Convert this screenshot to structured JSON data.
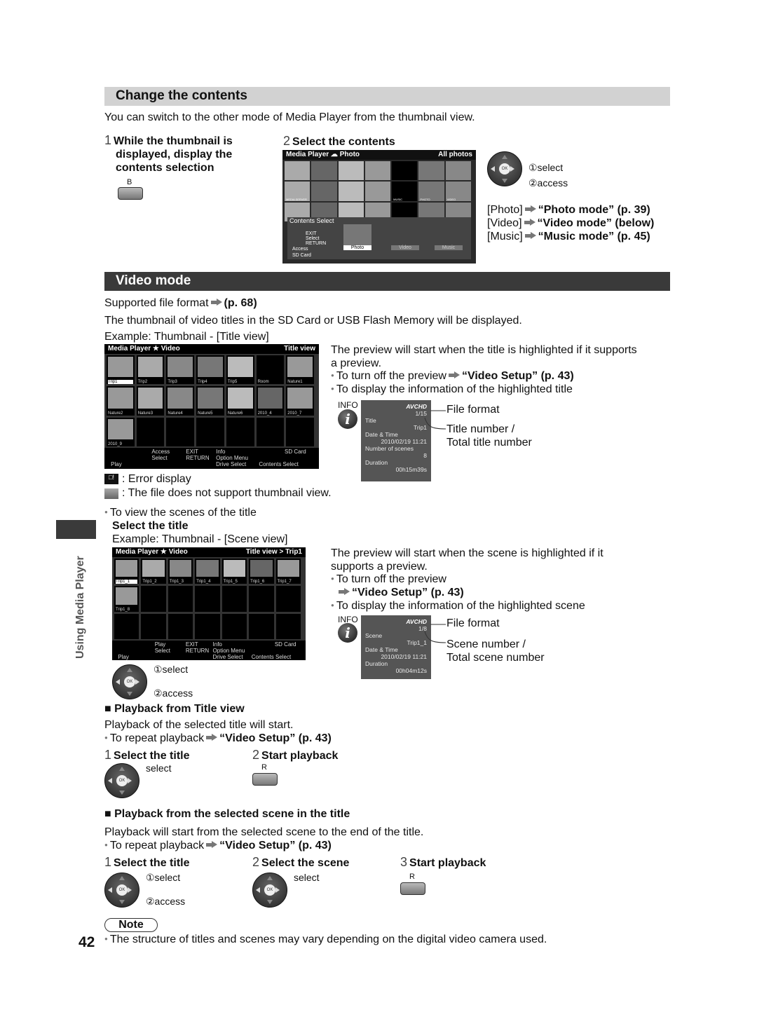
{
  "change": {
    "title": "Change the contents",
    "intro": "You can switch to the other mode of Media Player from the thumbnail view.",
    "step1": {
      "n": "1",
      "text": [
        "While the thumbnail is",
        "displayed, display the",
        "contents selection"
      ],
      "key": "B"
    },
    "step2": {
      "n": "2",
      "text": "Select the contents"
    },
    "screen": {
      "app": "Media Player",
      "mode": "Photo",
      "view": "All photos",
      "labels": [
        "MEDIA SERVER",
        "MUSIC",
        "PHOTO",
        "VIDEO"
      ],
      "panel_title": "Contents Select",
      "exit": "EXIT",
      "select": "Select",
      "return": "RETURN",
      "access": "Access",
      "drive": "SD Card",
      "options": [
        "Photo",
        "Video",
        "Music"
      ]
    },
    "pad": {
      "select": "①select",
      "access": "②access"
    },
    "links": [
      {
        "label": "[Photo]",
        "ref": "“Photo mode” (p. 39)"
      },
      {
        "label": "[Video]",
        "ref": "“Video mode” (below)"
      },
      {
        "label": "[Music]",
        "ref": "“Music mode” (p. 45)"
      }
    ]
  },
  "video": {
    "title": "Video mode",
    "supported": "Supported file format",
    "supported_ref": "(p. 68)",
    "desc": "The thumbnail of video titles in the SD Card or USB Flash Memory will be displayed.",
    "example": "Example: Thumbnail - [Title view]",
    "title_screen": {
      "app": "Media Player",
      "mode": "Video",
      "view": "Title view",
      "items": [
        "Trip1",
        "Trip2",
        "Trip3",
        "Trip4",
        "Trip5",
        "Room",
        "Nature1",
        "Nature2",
        "Nature3",
        "Nature4",
        "Nature5",
        "Nature6",
        "2010_4",
        "2010_7",
        "2010_9"
      ],
      "footer": {
        "access": "Access",
        "select": "Select",
        "exit": "EXIT",
        "return": "RETURN",
        "info": "Info",
        "option": "Option Menu",
        "drive": "SD Card",
        "play": "Play",
        "drive_select": "Drive Select",
        "contents_select": "Contents Select"
      }
    },
    "preview": [
      "The preview will start when the title is highlighted if it supports",
      "a preview."
    ],
    "turn_off": "To turn off the preview",
    "turn_off_ref": "“Video Setup” (p. 43)",
    "display_info": "To display the information of the highlighted title",
    "info1": {
      "label": "INFO",
      "format": "AVCHD",
      "count": "1/15",
      "rows": [
        [
          "Title",
          "Trip1"
        ],
        [
          "Date & Time",
          "2010/02/19 11:21"
        ],
        [
          "Number of scenes",
          "8"
        ],
        [
          "Duration",
          "00h15m39s"
        ]
      ],
      "callout_format": "File format",
      "callout_number": [
        "Title number /",
        "Total title number"
      ]
    },
    "error": ": Error display",
    "unsupported": ": The file does not support thumbnail view.",
    "scenes": "To view the scenes of the title",
    "select_title": "Select the title",
    "example2": "Example: Thumbnail - [Scene view]",
    "scene_screen": {
      "app": "Media Player",
      "mode": "Video",
      "view": "Title view  >  Trip1",
      "items": [
        "Trip1_1",
        "Trip1_2",
        "Trip1_3",
        "Trip1_4",
        "Trip1_5",
        "Trip1_6",
        "Trip1_7",
        "Trip1_8"
      ],
      "footer": {
        "access": "Play",
        "select": "Select",
        "exit": "EXIT",
        "return": "RETURN",
        "info": "Info",
        "option": "Option Menu",
        "drive": "SD Card",
        "play": "Play",
        "drive_select": "Drive Select",
        "contents_select": "Contents Select"
      }
    },
    "preview2": [
      "The preview will start when the scene is highlighted if it",
      "supports a preview."
    ],
    "turn_off2": "To turn off the preview",
    "turn_off2_ref": "“Video Setup” (p. 43)",
    "display_info2": "To display the information of the highlighted scene",
    "info2": {
      "label": "INFO",
      "format": "AVCHD",
      "count": "1/8",
      "rows": [
        [
          "Scene",
          "Trip1_1"
        ],
        [
          "Date & Time",
          "2010/02/19 11:21"
        ],
        [
          "Duration",
          "00h04m12s"
        ]
      ],
      "callout_format": "File format",
      "callout_number": [
        "Scene number /",
        "Total scene number"
      ]
    },
    "pad": {
      "select": "①select",
      "access": "②access"
    }
  },
  "pb_title": {
    "heading": "■ Playback from Title view",
    "desc": "Playback of the selected title will start.",
    "repeat": "To repeat playback",
    "repeat_ref": "“Video Setup” (p. 43)",
    "step1": {
      "n": "1",
      "text": "Select the title",
      "select": "select"
    },
    "step2": {
      "n": "2",
      "text": "Start playback",
      "key": "R"
    }
  },
  "pb_scene": {
    "heading": "■ Playback from the selected scene in the title",
    "desc": "Playback will start from the selected scene to the end of the title.",
    "repeat": "To repeat playback",
    "repeat_ref": "“Video Setup” (p. 43)",
    "step1": {
      "n": "1",
      "text": "Select the title",
      "select": "①select",
      "access": "②access"
    },
    "step2": {
      "n": "2",
      "text": "Select the scene",
      "select": "select"
    },
    "step3": {
      "n": "3",
      "text": "Start playback",
      "key": "R"
    }
  },
  "note": {
    "label": "Note",
    "text": "The structure of titles and scenes may vary depending on the digital video camera used."
  },
  "side_tab": "Using Media Player",
  "page_number": "42"
}
